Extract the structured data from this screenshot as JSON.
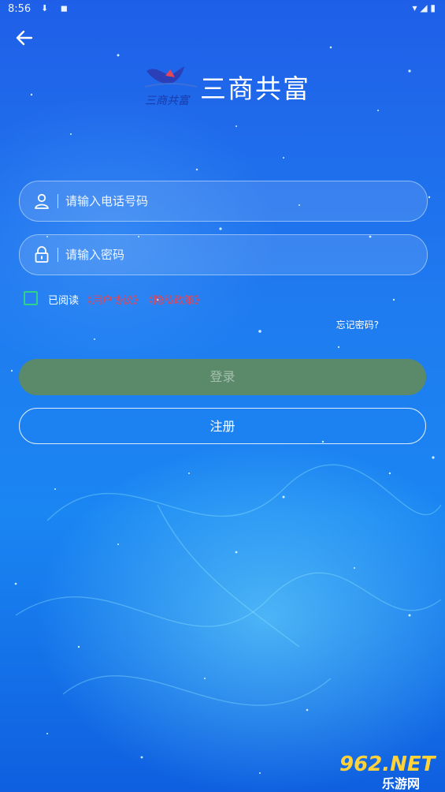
{
  "status_bar": {
    "time": "8:56",
    "left_icons": "⬇ ◼",
    "right_icons": "▾ ◢ ▮"
  },
  "header": {
    "back_icon": "arrow-left",
    "brand_title": "三商共富",
    "logo_text": "三商共富"
  },
  "form": {
    "phone_placeholder": "请输入电话号码",
    "phone_value": "",
    "password_placeholder": "请输入密码",
    "password_value": ""
  },
  "agreement": {
    "checked": false,
    "label": "已阅读",
    "user_agreement": "《用户协议》",
    "privacy_policy": "《隐私政策》"
  },
  "forgot_password": "忘记密码?",
  "buttons": {
    "login": "登录",
    "register": "注册"
  },
  "watermark": {
    "number": "962.NET",
    "site": "乐游网"
  },
  "colors": {
    "background": "#1f7cf0",
    "login_button": "#5a8a6a",
    "checkbox": "#2fd28a",
    "link": "#e2475a"
  }
}
